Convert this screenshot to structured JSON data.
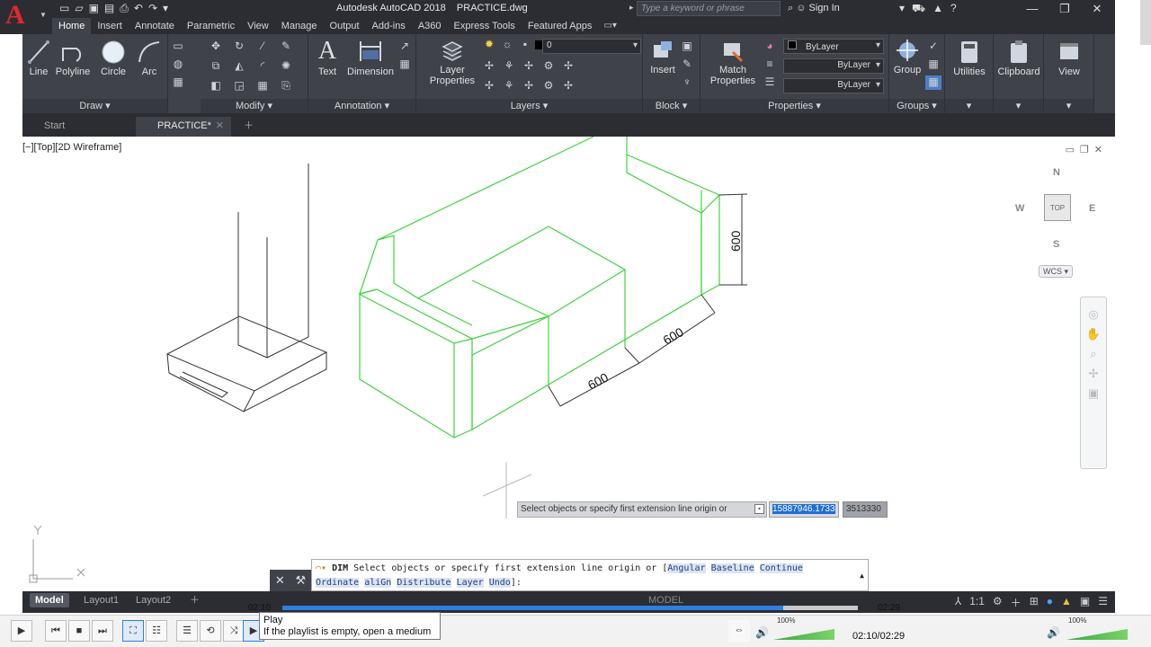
{
  "app": {
    "title": "Autodesk AutoCAD 2018    PRACTICE.dwg",
    "logo": "A",
    "search_placeholder": "Type a keyword or phrase",
    "signin": "Sign In"
  },
  "ribbon_tabs": [
    "Home",
    "Insert",
    "Annotate",
    "Parametric",
    "View",
    "Manage",
    "Output",
    "Add-ins",
    "A360",
    "Express Tools",
    "Featured Apps"
  ],
  "ribbon": {
    "draw": {
      "title": "Draw",
      "line": "Line",
      "polyline": "Polyline",
      "circle": "Circle",
      "arc": "Arc"
    },
    "modify": {
      "title": "Modify"
    },
    "annotation": {
      "title": "Annotation",
      "text": "Text",
      "dimension": "Dimension"
    },
    "layers": {
      "title": "Layers",
      "layer_properties_1": "Layer",
      "layer_properties_2": "Properties",
      "current_layer": "0"
    },
    "block": {
      "title": "Block",
      "insert": "Insert"
    },
    "properties": {
      "title": "Properties",
      "match_1": "Match",
      "match_2": "Properties",
      "color": "ByLayer",
      "linetype": "ByLayer",
      "lineweight": "ByLayer"
    },
    "groups": {
      "title": "Groups",
      "group": "Group"
    },
    "utilities": "Utilities",
    "clipboard": "Clipboard",
    "view": "View"
  },
  "doc_tabs": {
    "start": "Start",
    "practice": "PRACTICE*"
  },
  "viewport": {
    "label": "[−][Top][2D Wireframe]",
    "viewcube": {
      "n": "N",
      "s": "S",
      "e": "E",
      "w": "W",
      "top": "TOP",
      "wcs": "WCS"
    },
    "dimensions": [
      "600",
      "600",
      "600"
    ],
    "ucs": {
      "x": "X",
      "y": "Y"
    }
  },
  "dynamic_input": {
    "prompt": "Select objects or specify first extension line origin or",
    "value1": "15887946.1733",
    "value2": "3513330"
  },
  "command_line": {
    "command": "DIM",
    "text": "Select objects or specify first extension line origin or [",
    "options_row1": [
      "Angular",
      "Baseline",
      "Continue"
    ],
    "options_row2": [
      "Ordinate",
      "aliGn",
      "Distribute",
      "Layer",
      "Undo"
    ],
    "suffix": "]:"
  },
  "layout_tabs": [
    "Model",
    "Layout1",
    "Layout2"
  ],
  "status_bar": {
    "model": "MODEL",
    "scale": "1:1"
  },
  "player": {
    "time_left": "02:10",
    "time_right": "02:29",
    "progress": 0.87,
    "time_display": "02:10/02:29",
    "tooltip_title": "Play",
    "tooltip_text": "If the playlist is empty, open a medium",
    "volume_main": "100%",
    "volume_main_level": 1.0,
    "volume_right": "100%",
    "volume_right_level": 1.0
  },
  "colors": {
    "accent": "#2f7fe0",
    "dark_ui": "#2b2d33",
    "ribbon": "#3f4249",
    "sofa": "#3ed43e",
    "logo": "#e0282c"
  }
}
